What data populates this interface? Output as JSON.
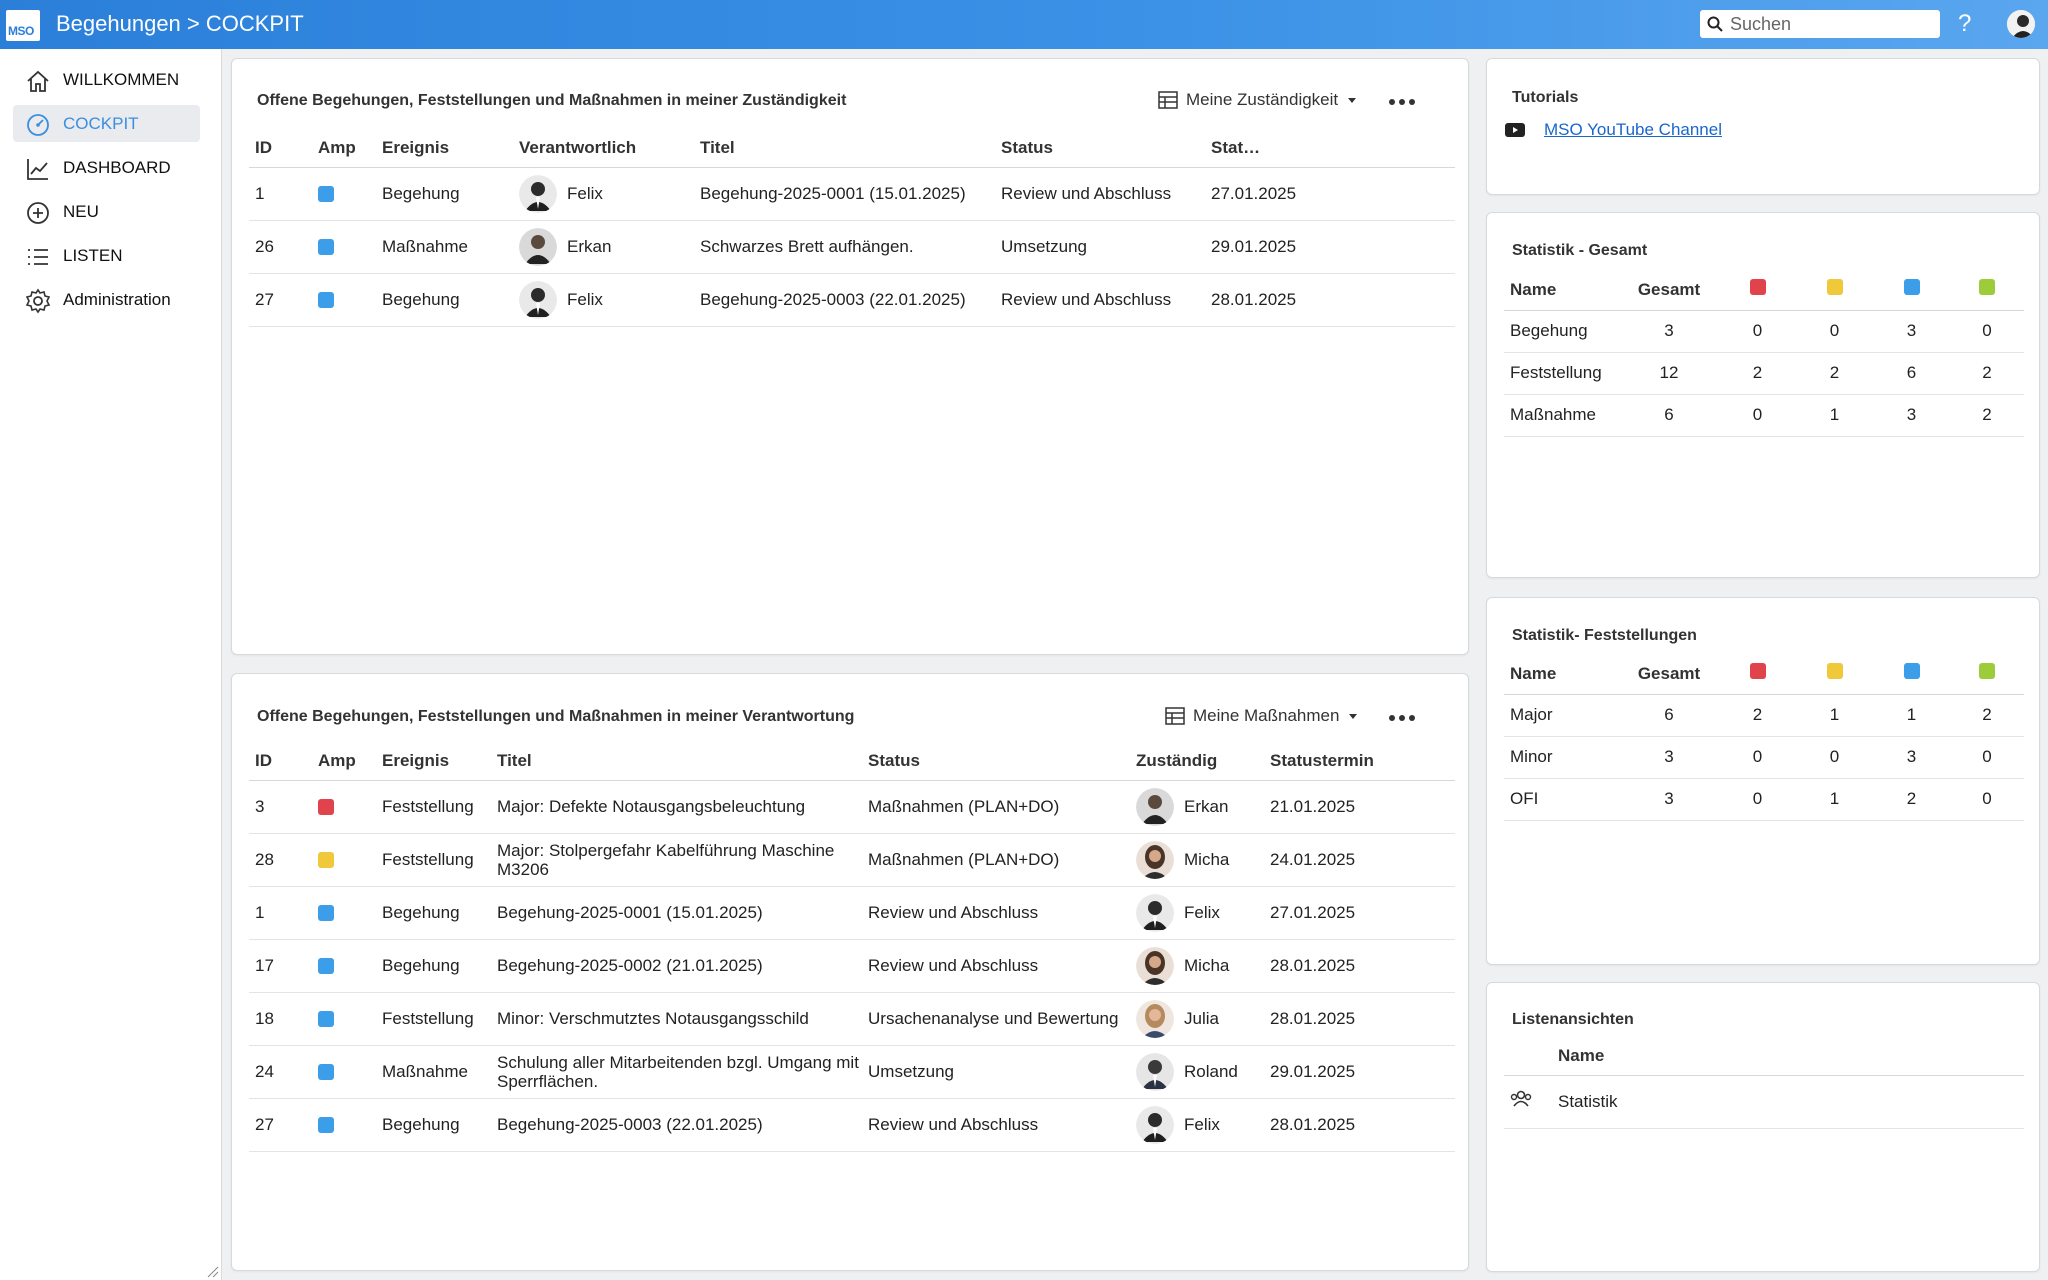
{
  "colors": {
    "red": "#e0434c",
    "yellow": "#f0c93a",
    "blue": "#3c9ee8",
    "green": "#9ccc3a",
    "accent": "#3b8ee0"
  },
  "header": {
    "logo_text": "MSO",
    "title": "Begehungen > COCKPIT",
    "search_placeholder": "Suchen",
    "help": "?"
  },
  "sidebar": {
    "items": [
      {
        "label": "WILLKOMMEN",
        "icon": "home-icon"
      },
      {
        "label": "COCKPIT",
        "icon": "gauge-icon",
        "active": true
      },
      {
        "label": "DASHBOARD",
        "icon": "chart-line-icon"
      },
      {
        "label": "NEU",
        "icon": "plus-circle-icon"
      },
      {
        "label": "LISTEN",
        "icon": "list-icon"
      },
      {
        "label": "Administration",
        "icon": "gear-icon"
      }
    ]
  },
  "card1": {
    "title": "Offene Begehungen, Feststellungen und Maßnahmen in meiner Zuständigkeit",
    "view": "Meine Zuständigkeit",
    "columns": [
      "ID",
      "Amp",
      "Ereignis",
      "Verantwortlich",
      "Titel",
      "Status",
      "Stat…"
    ],
    "rows": [
      {
        "id": "1",
        "amp": "blue",
        "ereignis": "Begehung",
        "person": "Felix",
        "titel": "Begehung-2025-0001 (15.01.2025)",
        "status": "Review und Abschluss",
        "date": "27.01.2025"
      },
      {
        "id": "26",
        "amp": "blue",
        "ereignis": "Maßnahme",
        "person": "Erkan",
        "titel": "Schwarzes Brett aufhängen.",
        "status": "Umsetzung",
        "date": "29.01.2025"
      },
      {
        "id": "27",
        "amp": "blue",
        "ereignis": "Begehung",
        "person": "Felix",
        "titel": "Begehung-2025-0003 (22.01.2025)",
        "status": "Review und Abschluss",
        "date": "28.01.2025"
      }
    ]
  },
  "card2": {
    "title": "Offene Begehungen, Feststellungen und Maßnahmen in meiner Verantwortung",
    "view": "Meine Maßnahmen",
    "columns": [
      "ID",
      "Amp",
      "Ereignis",
      "Titel",
      "Status",
      "Zuständig",
      "Statustermin"
    ],
    "rows": [
      {
        "id": "3",
        "amp": "red",
        "ereignis": "Feststellung",
        "titel": "Major: Defekte Notausgangsbeleuchtung",
        "status": "Maßnahmen (PLAN+DO)",
        "person": "Erkan",
        "date": "21.01.2025"
      },
      {
        "id": "28",
        "amp": "yellow",
        "ereignis": "Feststellung",
        "titel": "Major: Stolpergefahr Kabelführung Maschine M3206",
        "status": "Maßnahmen (PLAN+DO)",
        "person": "Micha",
        "date": "24.01.2025"
      },
      {
        "id": "1",
        "amp": "blue",
        "ereignis": "Begehung",
        "titel": "Begehung-2025-0001 (15.01.2025)",
        "status": "Review und Abschluss",
        "person": "Felix",
        "date": "27.01.2025"
      },
      {
        "id": "17",
        "amp": "blue",
        "ereignis": "Begehung",
        "titel": "Begehung-2025-0002 (21.01.2025)",
        "status": "Review und Abschluss",
        "person": "Micha",
        "date": "28.01.2025"
      },
      {
        "id": "18",
        "amp": "blue",
        "ereignis": "Feststellung",
        "titel": "Minor: Verschmutztes Notausgangsschild",
        "status": "Ursachenanalyse und Bewertung",
        "person": "Julia",
        "date": "28.01.2025"
      },
      {
        "id": "24",
        "amp": "blue",
        "ereignis": "Maßnahme",
        "titel": "Schulung aller Mitarbeitenden bzgl. Umgang mit Sperrflächen.",
        "status": "Umsetzung",
        "person": "Roland",
        "date": "29.01.2025"
      },
      {
        "id": "27",
        "amp": "blue",
        "ereignis": "Begehung",
        "titel": "Begehung-2025-0003 (22.01.2025)",
        "status": "Review und Abschluss",
        "person": "Felix",
        "date": "28.01.2025"
      }
    ]
  },
  "tutorials": {
    "title": "Tutorials",
    "link": "MSO YouTube Channel",
    "icon": "youtube-icon"
  },
  "stats_total": {
    "title": "Statistik - Gesamt",
    "columns": [
      "Name",
      "Gesamt"
    ],
    "rows": [
      {
        "name": "Begehung",
        "values": [
          "3",
          "0",
          "0",
          "3",
          "0"
        ]
      },
      {
        "name": "Feststellung",
        "values": [
          "12",
          "2",
          "2",
          "6",
          "2"
        ]
      },
      {
        "name": "Maßnahme",
        "values": [
          "6",
          "0",
          "1",
          "3",
          "2"
        ]
      }
    ]
  },
  "stats_findings": {
    "title": "Statistik- Feststellungen",
    "columns": [
      "Name",
      "Gesamt"
    ],
    "rows": [
      {
        "name": "Major",
        "values": [
          "6",
          "2",
          "1",
          "1",
          "2"
        ]
      },
      {
        "name": "Minor",
        "values": [
          "3",
          "0",
          "0",
          "3",
          "0"
        ]
      },
      {
        "name": "OFI",
        "values": [
          "3",
          "0",
          "1",
          "2",
          "0"
        ]
      }
    ]
  },
  "list_views": {
    "title": "Listenansichten",
    "column": "Name",
    "rows": [
      {
        "name": "Statistik",
        "icon": "users-icon"
      }
    ]
  }
}
